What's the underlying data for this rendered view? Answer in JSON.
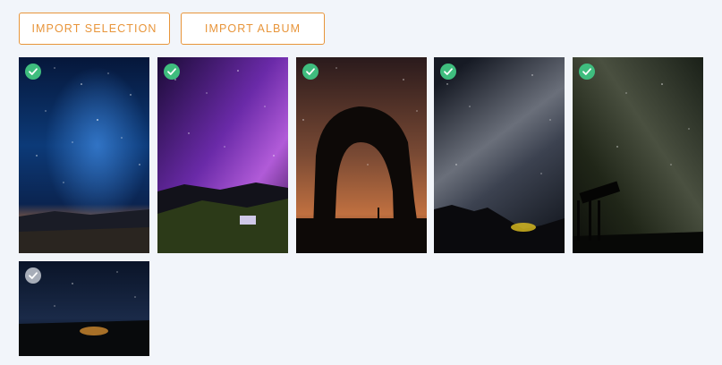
{
  "toolbar": {
    "import_selection_label": "IMPORT SELECTION",
    "import_album_label": "IMPORT ALBUM"
  },
  "colors": {
    "accent": "#e8953a",
    "page_background": "#f2f5fa",
    "selected_check": "#3fbd7e",
    "unselected_check": "#a7adb8"
  },
  "photos": [
    {
      "subject": "blue-starry-sky-over-town",
      "selected": true
    },
    {
      "subject": "purple-milky-way-over-hills",
      "selected": true
    },
    {
      "subject": "milky-way-through-rock-arch",
      "selected": true
    },
    {
      "subject": "milky-way-over-mountain-ridge",
      "selected": true
    },
    {
      "subject": "telescope-silhouette-under-stars",
      "selected": true
    },
    {
      "subject": "night-sky-over-treeline-with-lights",
      "selected": false
    }
  ],
  "icons": {
    "check": "check-icon"
  }
}
